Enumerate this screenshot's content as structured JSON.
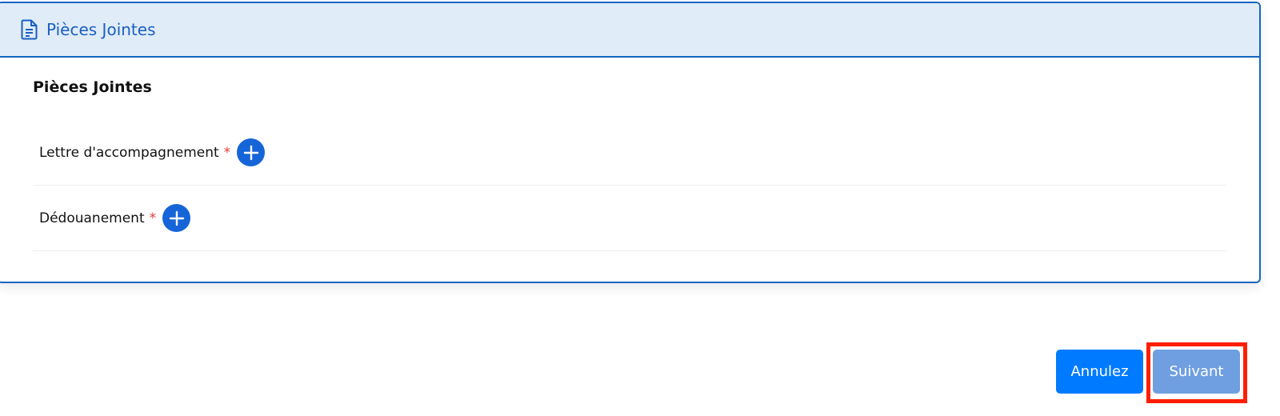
{
  "card": {
    "header_title": "Pièces Jointes",
    "header_icon": "document-icon",
    "section_title": "Pièces Jointes"
  },
  "attachments": [
    {
      "label": "Lettre d'accompagnement",
      "required_mark": "*",
      "add_icon": "plus-icon"
    },
    {
      "label": "Dédouanement",
      "required_mark": "*",
      "add_icon": "plus-icon"
    }
  ],
  "actions": {
    "cancel_label": "Annulez",
    "next_label": "Suivant"
  },
  "colors": {
    "accent": "#1565c0",
    "header_bg": "#e0ecf8",
    "cancel_bg": "#007bff",
    "next_bg": "#6f9fe0",
    "required": "#e53935",
    "highlight": "#ff1e00"
  }
}
